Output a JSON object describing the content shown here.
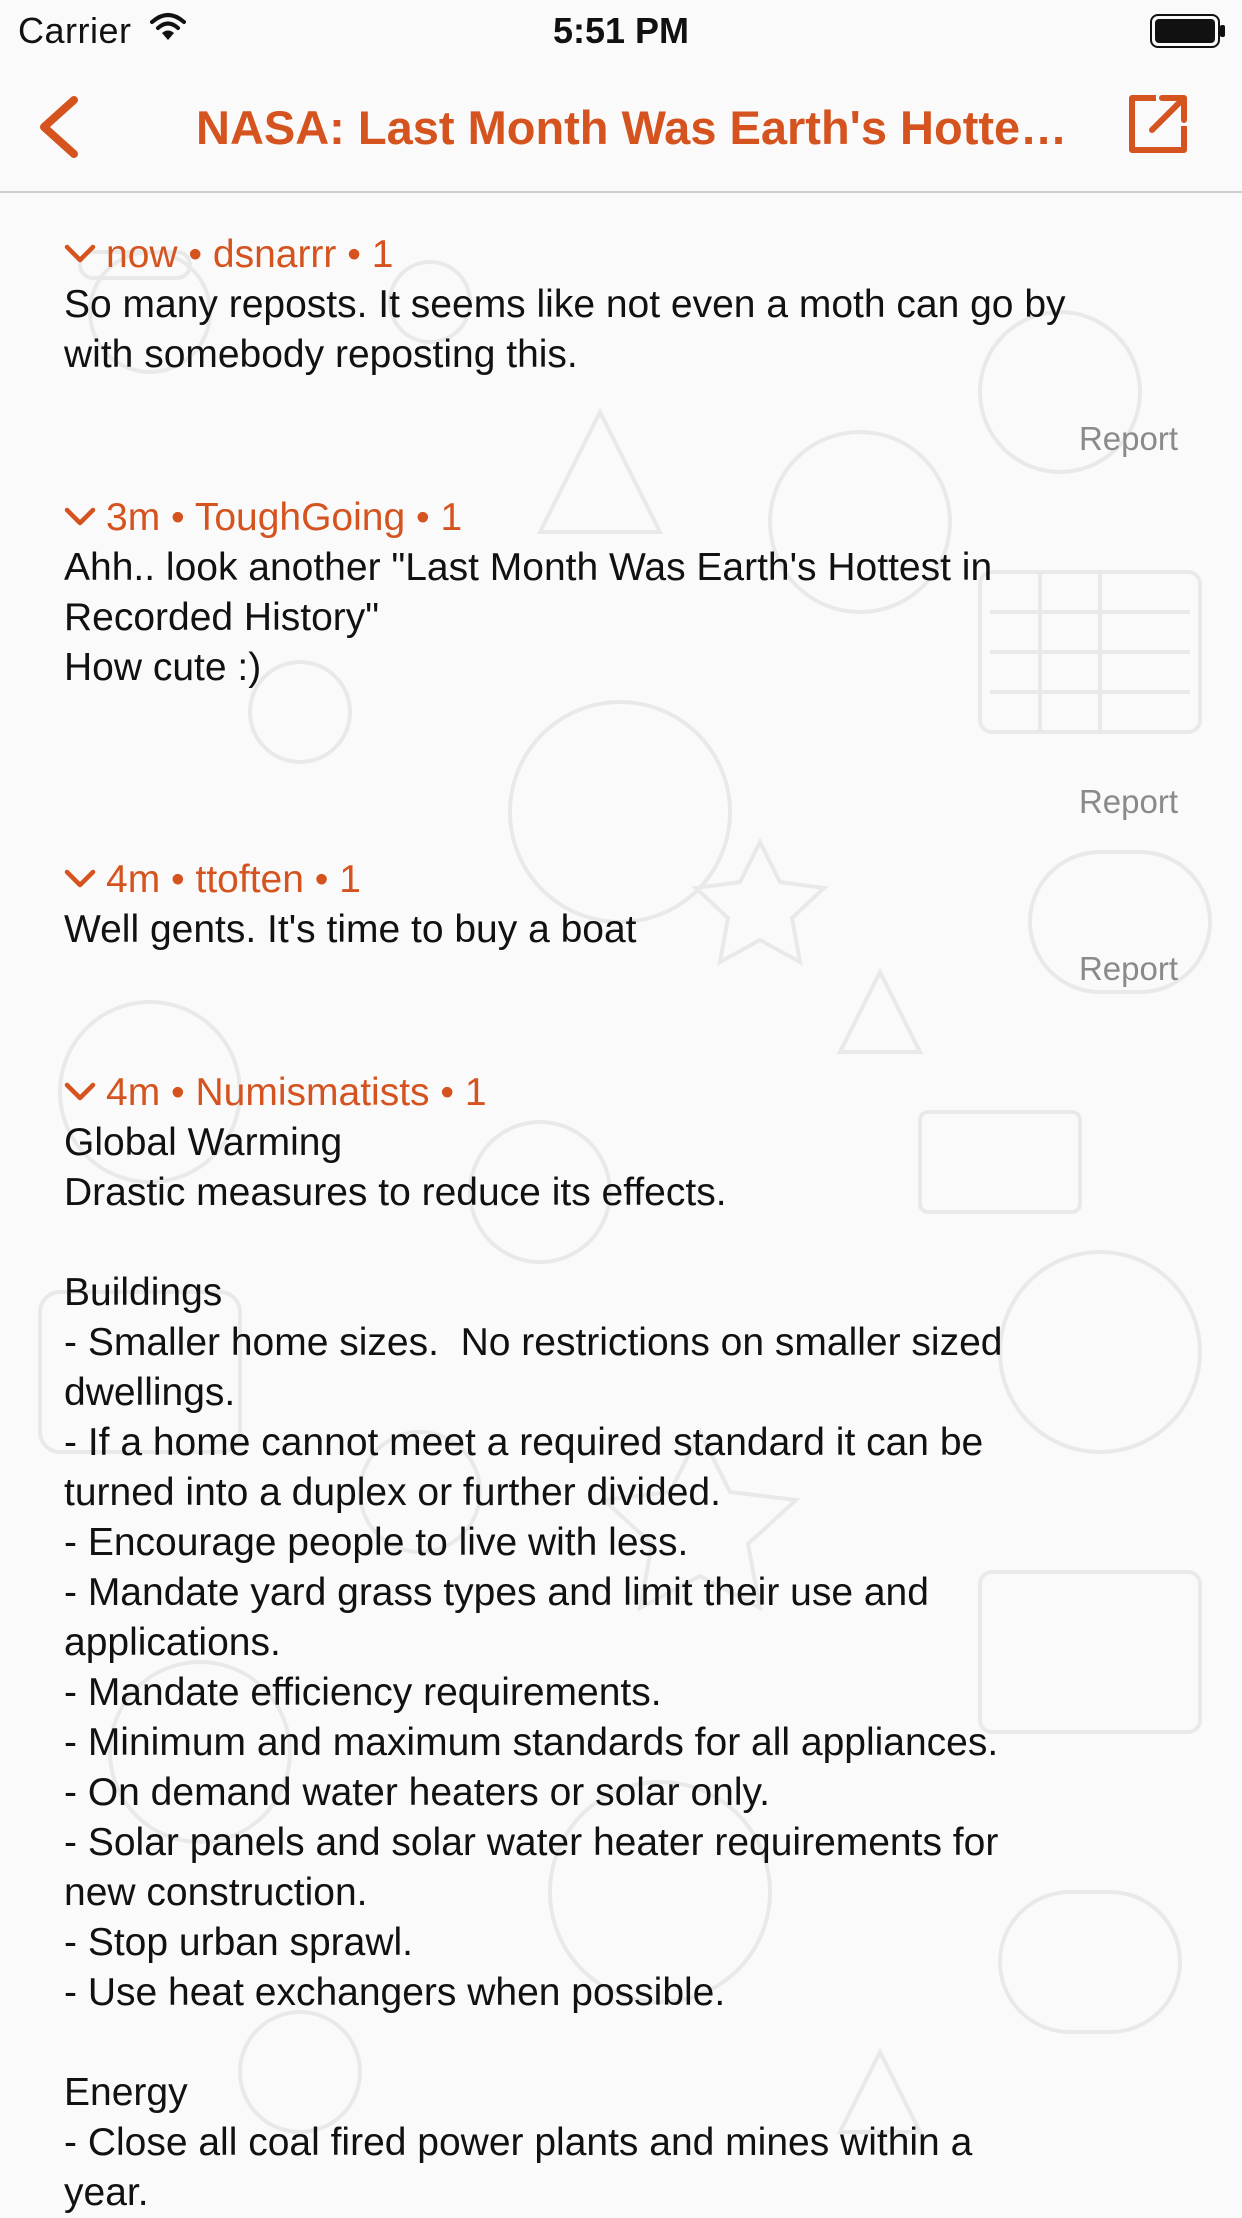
{
  "status_bar": {
    "carrier": "Carrier",
    "time": "5:51 PM"
  },
  "nav": {
    "title": "NASA: Last Month Was Earth's Hottest in Recorded History",
    "back_icon": "chevron-left-icon",
    "share_icon": "external-link-icon"
  },
  "colors": {
    "accent": "#d4531f",
    "background": "#fafafa",
    "report_text": "#8a8a8a"
  },
  "comments": [
    {
      "time": "now",
      "author": "dsnarrr",
      "score": "1",
      "lines": [
        "So many reposts. It seems like not even a moth can go by",
        "with somebody reposting this."
      ],
      "report_label": "Report"
    },
    {
      "time": "3m",
      "author": "ToughGoing",
      "score": "1",
      "lines": [
        "Ahh.. look another \"Last Month Was Earth's Hottest in",
        "Recorded History\"",
        "How cute :)"
      ],
      "report_label": "Report"
    },
    {
      "time": "4m",
      "author": "ttoften",
      "score": "1",
      "lines": [
        "Well gents. It's time to buy a boat"
      ],
      "report_label": "Report"
    },
    {
      "time": "4m",
      "author": "Numismatists",
      "score": "1",
      "lines": [
        "Global Warming",
        "Drastic measures to reduce its effects.",
        "",
        "Buildings",
        "- Smaller home sizes.  No restrictions on smaller sized",
        "dwellings.",
        "- If a home cannot meet a required standard it can be",
        "turned into a duplex or further divided.",
        "- Encourage people to live with less.",
        "- Mandate yard grass types and limit their use and",
        "applications.",
        "- Mandate efficiency requirements.",
        "- Minimum and maximum standards for all appliances.",
        "- On demand water heaters or solar only.",
        "- Solar panels and solar water heater requirements for",
        "new construction.",
        "- Stop urban sprawl.",
        "- Use heat exchangers when possible.",
        "",
        "Energy",
        "- Close all coal fired power plants and mines within a",
        "year."
      ]
    }
  ]
}
